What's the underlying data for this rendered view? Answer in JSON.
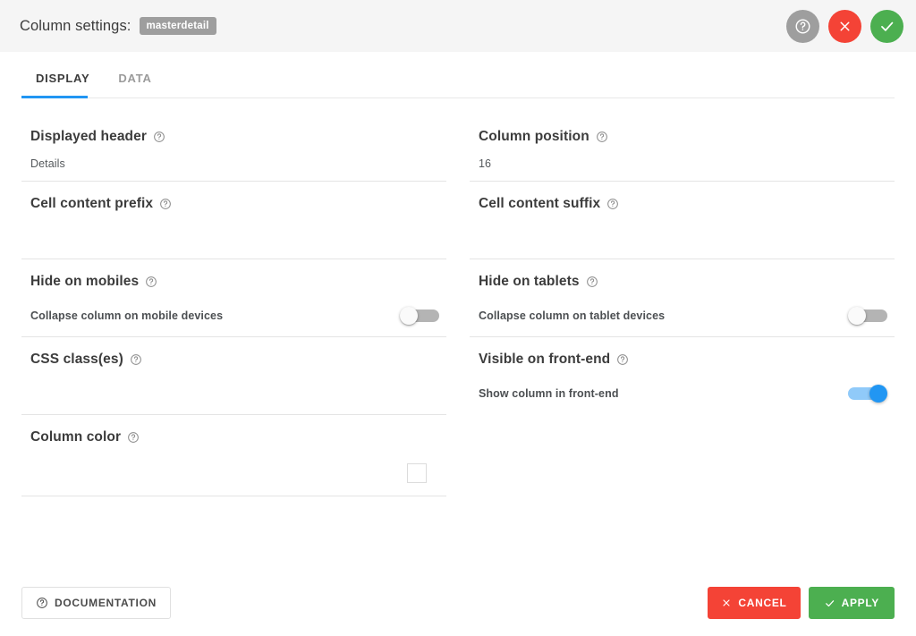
{
  "header": {
    "title": "Column settings:",
    "badge": "masterdetail",
    "buttons": [
      {
        "name": "help",
        "icon": "help-circle-icon",
        "color": "#9e9e9e"
      },
      {
        "name": "close",
        "icon": "close-x-icon",
        "color": "#f44336"
      },
      {
        "name": "confirm",
        "icon": "check-icon",
        "color": "#4caf50"
      }
    ]
  },
  "tabs": [
    {
      "label": "DISPLAY",
      "active": true
    },
    {
      "label": "DATA",
      "active": false
    }
  ],
  "accent_color": "#2196f3",
  "form": {
    "left": [
      {
        "label": "Displayed header",
        "value": "Details",
        "help_icon": "help-circle-icon"
      },
      {
        "label": "Cell content prefix",
        "value": "",
        "help_icon": "help-circle-icon"
      },
      {
        "label": "Hide on mobiles",
        "caption": "Collapse column on mobile devices",
        "toggle": "off",
        "help_icon": "help-circle-icon"
      },
      {
        "label": "CSS class(es)",
        "value": "",
        "help_icon": "help-circle-icon"
      },
      {
        "label": "Column color",
        "swatch": "#ffffff",
        "help_icon": "help-circle-icon"
      }
    ],
    "right": [
      {
        "label": "Column position",
        "value": "16",
        "help_icon": "help-circle-icon"
      },
      {
        "label": "Cell content suffix",
        "value": "",
        "help_icon": "help-circle-icon"
      },
      {
        "label": "Hide on tablets",
        "caption": "Collapse column on tablet devices",
        "toggle": "off",
        "help_icon": "help-circle-icon"
      },
      {
        "label": "Visible on front-end",
        "caption": "Show column in front-end",
        "toggle": "on",
        "help_icon": "help-circle-icon"
      }
    ]
  },
  "footer": {
    "documentation": "DOCUMENTATION",
    "documentation_icon": "help-circle-icon",
    "cancel": "CANCEL",
    "cancel_icon": "close-x-icon",
    "apply": "APPLY",
    "apply_icon": "check-icon"
  }
}
